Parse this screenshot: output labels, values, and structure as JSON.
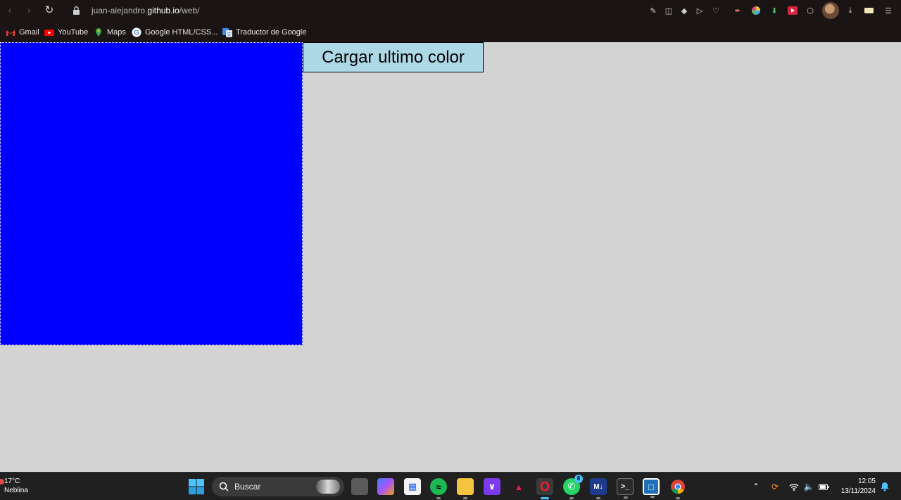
{
  "browser": {
    "url_prefix": "juan-alejandro.",
    "url_host": "github.io",
    "url_path": "/web/"
  },
  "bookmarks": [
    {
      "label": "Gmail",
      "icon": "gmail-icon"
    },
    {
      "label": "YouTube",
      "icon": "youtube-icon"
    },
    {
      "label": "Maps",
      "icon": "maps-icon"
    },
    {
      "label": "Google HTML/CSS...",
      "icon": "google-icon"
    },
    {
      "label": "Traductor de Google",
      "icon": "translate-icon"
    }
  ],
  "page": {
    "box_color": "#0000ff",
    "button_label": "Cargar ultimo color",
    "button_color": "#add8e6",
    "background": "#d3d3d3"
  },
  "taskbar": {
    "weather_temp": "17°C",
    "weather_desc": "Neblina",
    "search_placeholder": "Buscar",
    "whatsapp_badge": "8",
    "time": "12:05",
    "date": "13/11/2024"
  }
}
